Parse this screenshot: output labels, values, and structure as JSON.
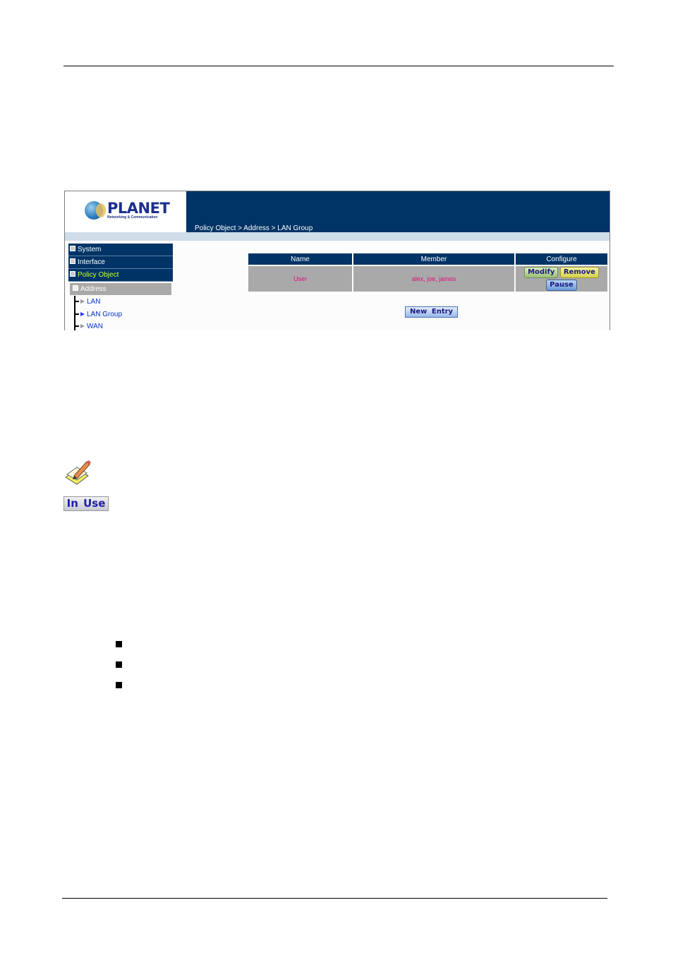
{
  "app": {
    "logo": {
      "brand": "PLANET",
      "tagline": "Networking & Communication"
    },
    "breadcrumb": "Policy Object > Address > LAN Group"
  },
  "sidebar": {
    "menu": [
      {
        "label": "System",
        "expanded": false
      },
      {
        "label": "Interface",
        "expanded": false
      },
      {
        "label": "Policy Object",
        "expanded": true,
        "active": true
      }
    ],
    "submenu": {
      "label": "Address",
      "expanded": true
    },
    "items": [
      {
        "label": "LAN",
        "active": false
      },
      {
        "label": "LAN Group",
        "active": true
      },
      {
        "label": "WAN",
        "active": false
      }
    ]
  },
  "table": {
    "columns": [
      "Name",
      "Member",
      "Configure"
    ],
    "rows": [
      {
        "name": "User",
        "member": "alex, joe, james",
        "actions": [
          "Modify",
          "Remove",
          "Pause"
        ]
      }
    ]
  },
  "new_entry_label": "New Entry",
  "in_use_label": "In Use",
  "colors": {
    "banner": "#003366",
    "active_menu_text": "#ccff33",
    "cell_text": "#e0107a",
    "row_bg": "#a9a9a9"
  }
}
